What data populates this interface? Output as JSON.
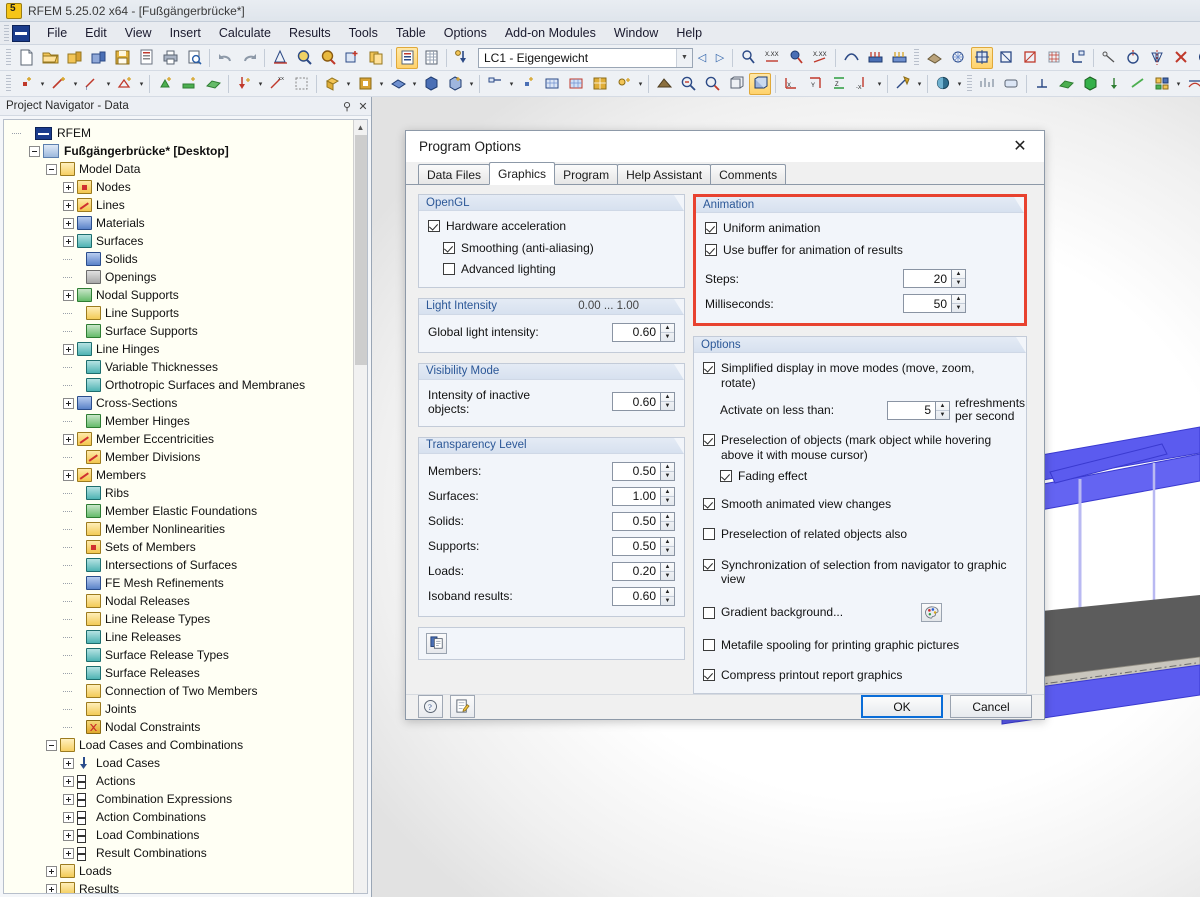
{
  "window": {
    "title": "RFEM 5.25.02 x64 - [Fußgängerbrücke*]",
    "app_icon": "rfem-icon"
  },
  "menubar": {
    "items": [
      {
        "label": "File"
      },
      {
        "label": "Edit"
      },
      {
        "label": "View"
      },
      {
        "label": "Insert"
      },
      {
        "label": "Calculate"
      },
      {
        "label": "Results"
      },
      {
        "label": "Tools"
      },
      {
        "label": "Table"
      },
      {
        "label": "Options"
      },
      {
        "label": "Add-on Modules"
      },
      {
        "label": "Window"
      },
      {
        "label": "Help"
      }
    ]
  },
  "toolbar": {
    "load_case_value": "LC1 - Eigengewicht"
  },
  "navigator": {
    "title": "Project Navigator - Data",
    "pin_icon": "pin-icon",
    "close_icon": "close-icon",
    "tree": [
      {
        "label": "RFEM",
        "depth": 0,
        "icon": "app-icon",
        "expander": "none",
        "bold": false
      },
      {
        "label": "Fußgängerbrücke* [Desktop]",
        "depth": 1,
        "icon": "doc-icon",
        "expander": "minus",
        "bold": true
      },
      {
        "label": "Model Data",
        "depth": 2,
        "icon": "folder-open",
        "expander": "minus",
        "bold": false
      },
      {
        "label": "Nodes",
        "depth": 3,
        "icon": "red",
        "expander": "plus",
        "bold": false
      },
      {
        "label": "Lines",
        "depth": 3,
        "icon": "lines",
        "expander": "plus",
        "bold": false
      },
      {
        "label": "Materials",
        "depth": 3,
        "icon": "blue",
        "expander": "plus",
        "bold": false
      },
      {
        "label": "Surfaces",
        "depth": 3,
        "icon": "teal",
        "expander": "plus",
        "bold": false
      },
      {
        "label": "Solids",
        "depth": 3,
        "icon": "blue",
        "expander": "none",
        "bold": false
      },
      {
        "label": "Openings",
        "depth": 3,
        "icon": "gray",
        "expander": "none",
        "bold": false
      },
      {
        "label": "Nodal Supports",
        "depth": 3,
        "icon": "green",
        "expander": "plus",
        "bold": false
      },
      {
        "label": "Line Supports",
        "depth": 3,
        "icon": "plain",
        "expander": "none",
        "bold": false
      },
      {
        "label": "Surface Supports",
        "depth": 3,
        "icon": "green",
        "expander": "none",
        "bold": false
      },
      {
        "label": "Line Hinges",
        "depth": 3,
        "icon": "teal",
        "expander": "plus",
        "bold": false
      },
      {
        "label": "Variable Thicknesses",
        "depth": 3,
        "icon": "teal",
        "expander": "none",
        "bold": false
      },
      {
        "label": "Orthotropic Surfaces and Membranes",
        "depth": 3,
        "icon": "teal",
        "expander": "none",
        "bold": false
      },
      {
        "label": "Cross-Sections",
        "depth": 3,
        "icon": "blue",
        "expander": "plus",
        "bold": false
      },
      {
        "label": "Member Hinges",
        "depth": 3,
        "icon": "green",
        "expander": "none",
        "bold": false
      },
      {
        "label": "Member Eccentricities",
        "depth": 3,
        "icon": "lines",
        "expander": "plus",
        "bold": false
      },
      {
        "label": "Member Divisions",
        "depth": 3,
        "icon": "lines",
        "expander": "none",
        "bold": false
      },
      {
        "label": "Members",
        "depth": 3,
        "icon": "lines",
        "expander": "plus",
        "bold": false
      },
      {
        "label": "Ribs",
        "depth": 3,
        "icon": "teal",
        "expander": "none",
        "bold": false
      },
      {
        "label": "Member Elastic Foundations",
        "depth": 3,
        "icon": "green",
        "expander": "none",
        "bold": false
      },
      {
        "label": "Member Nonlinearities",
        "depth": 3,
        "icon": "plain",
        "expander": "none",
        "bold": false
      },
      {
        "label": "Sets of Members",
        "depth": 3,
        "icon": "red",
        "expander": "none",
        "bold": false
      },
      {
        "label": "Intersections of Surfaces",
        "depth": 3,
        "icon": "teal",
        "expander": "none",
        "bold": false
      },
      {
        "label": "FE Mesh Refinements",
        "depth": 3,
        "icon": "blue",
        "expander": "none",
        "bold": false
      },
      {
        "label": "Nodal Releases",
        "depth": 3,
        "icon": "plain",
        "expander": "none",
        "bold": false
      },
      {
        "label": "Line Release Types",
        "depth": 3,
        "icon": "plain",
        "expander": "none",
        "bold": false
      },
      {
        "label": "Line Releases",
        "depth": 3,
        "icon": "teal",
        "expander": "none",
        "bold": false
      },
      {
        "label": "Surface Release Types",
        "depth": 3,
        "icon": "teal",
        "expander": "none",
        "bold": false
      },
      {
        "label": "Surface Releases",
        "depth": 3,
        "icon": "teal",
        "expander": "none",
        "bold": false
      },
      {
        "label": "Connection of Two Members",
        "depth": 3,
        "icon": "plain",
        "expander": "none",
        "bold": false
      },
      {
        "label": "Joints",
        "depth": 3,
        "icon": "plain",
        "expander": "none",
        "bold": false
      },
      {
        "label": "Nodal Constraints",
        "depth": 3,
        "icon": "nc",
        "expander": "none",
        "bold": false
      },
      {
        "label": "Load Cases and Combinations",
        "depth": 2,
        "icon": "folder-open",
        "expander": "minus",
        "bold": false
      },
      {
        "label": "Load Cases",
        "depth": 3,
        "icon": "arrowdn",
        "expander": "plus",
        "bold": false
      },
      {
        "label": "Actions",
        "depth": 3,
        "icon": "combo",
        "expander": "plus",
        "bold": false
      },
      {
        "label": "Combination Expressions",
        "depth": 3,
        "icon": "combo",
        "expander": "plus",
        "bold": false
      },
      {
        "label": "Action Combinations",
        "depth": 3,
        "icon": "combo",
        "expander": "plus",
        "bold": false
      },
      {
        "label": "Load Combinations",
        "depth": 3,
        "icon": "combo",
        "expander": "plus",
        "bold": false
      },
      {
        "label": "Result Combinations",
        "depth": 3,
        "icon": "combo",
        "expander": "plus",
        "bold": false
      },
      {
        "label": "Loads",
        "depth": 2,
        "icon": "plain",
        "expander": "plus",
        "bold": false
      },
      {
        "label": "Results",
        "depth": 2,
        "icon": "plain",
        "expander": "plus",
        "bold": false
      }
    ]
  },
  "dialog": {
    "title": "Program Options",
    "close_icon": "close-icon",
    "tabs": [
      {
        "label": "Data Files",
        "active": false
      },
      {
        "label": "Graphics",
        "active": true
      },
      {
        "label": "Program",
        "active": false
      },
      {
        "label": "Help Assistant",
        "active": false
      },
      {
        "label": "Comments",
        "active": false
      }
    ],
    "opengl": {
      "title": "OpenGL",
      "items": [
        {
          "label": "Hardware acceleration",
          "checked": true,
          "indent": 0
        },
        {
          "label": "Smoothing (anti-aliasing)",
          "checked": true,
          "indent": 1
        },
        {
          "label": "Advanced lighting",
          "checked": false,
          "indent": 1
        }
      ]
    },
    "animation": {
      "title": "Animation",
      "highlight_color": "#e8422f",
      "items": [
        {
          "label": "Uniform animation",
          "checked": true
        },
        {
          "label": "Use buffer for animation of results",
          "checked": true
        }
      ],
      "fields": [
        {
          "label": "Steps:",
          "value": "20"
        },
        {
          "label": "Milliseconds:",
          "value": "50"
        }
      ]
    },
    "light_intensity": {
      "title": "Light Intensity",
      "range": "0.00 ... 1.00",
      "fields": [
        {
          "label": "Global light intensity:",
          "value": "0.60"
        }
      ]
    },
    "visibility_mode": {
      "title": "Visibility Mode",
      "fields": [
        {
          "label": "Intensity of inactive objects:",
          "value": "0.60"
        }
      ]
    },
    "transparency_level": {
      "title": "Transparency Level",
      "fields": [
        {
          "label": "Members:",
          "value": "0.50"
        },
        {
          "label": "Surfaces:",
          "value": "1.00"
        },
        {
          "label": "Solids:",
          "value": "0.50"
        },
        {
          "label": "Supports:",
          "value": "0.50"
        },
        {
          "label": "Loads:",
          "value": "0.20"
        },
        {
          "label": "Isoband results:",
          "value": "0.60"
        }
      ]
    },
    "copy_bar": {
      "icon": "copy-icon"
    },
    "options": {
      "title": "Options",
      "simplified_display": {
        "label": "Simplified display in move modes (move, zoom, rotate)",
        "checked": true
      },
      "activate_on_less_than": {
        "label": "Activate on less than:",
        "value": "5",
        "suffix": "refreshments per second"
      },
      "preselection": {
        "label": "Preselection of objects (mark object while hovering above it with mouse cursor)",
        "checked": true
      },
      "fading_effect": {
        "label": "Fading effect",
        "checked": true
      },
      "items": [
        {
          "label": "Smooth animated view changes",
          "checked": true
        },
        {
          "label": "Preselection of related objects also",
          "checked": false
        },
        {
          "label": "Synchronization of selection from navigator to graphic view",
          "checked": true
        },
        {
          "label": "Gradient background...",
          "checked": false,
          "has_palette": true
        },
        {
          "label": "Metafile spooling for printing graphic pictures",
          "checked": false
        },
        {
          "label": "Compress printout report graphics",
          "checked": true
        }
      ]
    },
    "footer": {
      "help_icon": "help-icon",
      "edit_icon": "edit-icon",
      "ok_label": "OK",
      "cancel_label": "Cancel"
    }
  },
  "viewport": {
    "model_colors": {
      "member": "#5b5bef",
      "deck": "#5c5c5c",
      "cable": "#b9b9f2"
    }
  }
}
